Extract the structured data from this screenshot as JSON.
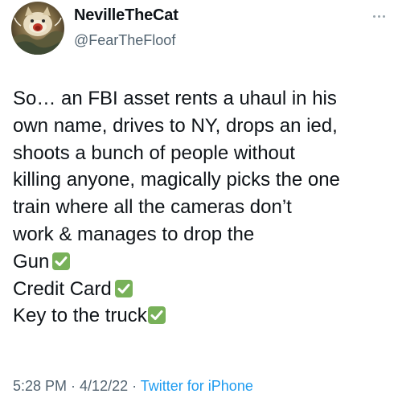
{
  "author": {
    "display_name": "NevilleTheCat",
    "handle": "@FearTheFloof",
    "avatar_icon": "cat-avatar"
  },
  "more_icon": "more-options-icon",
  "tweet": {
    "lines": [
      "So… an FBI asset rents a uhaul in his",
      "own name, drives to NY, drops an ied,",
      "shoots a bunch of people without",
      "killing anyone, magically picks the one",
      "train where all the cameras don’t",
      "work & manages to drop the"
    ],
    "checklist": [
      {
        "label": "Gun",
        "icon": "check-mark-button-emoji"
      },
      {
        "label": "Credit Card",
        "icon": "check-mark-button-emoji"
      },
      {
        "label": "Key to the truck",
        "icon": "check-mark-button-emoji"
      }
    ]
  },
  "meta": {
    "time": "5:28 PM",
    "separator": " · ",
    "date": "4/12/22",
    "source": "Twitter for iPhone"
  },
  "colors": {
    "text": "#0f1419",
    "secondary": "#536471",
    "link": "#1d9bf0",
    "check_green": "#78b159"
  }
}
